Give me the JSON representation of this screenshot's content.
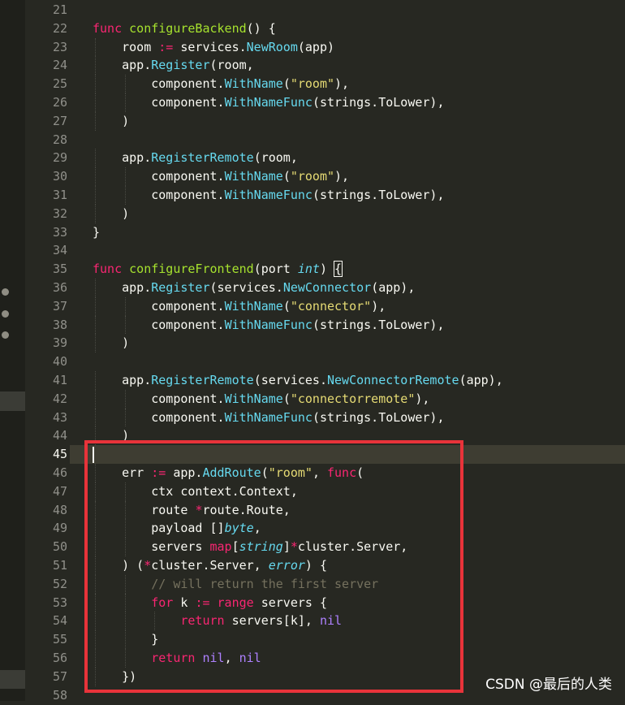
{
  "editor": {
    "lines": [
      {
        "n": "21",
        "segs": []
      },
      {
        "n": "22",
        "segs": [
          [
            "kw",
            "func"
          ],
          [
            "p",
            " "
          ],
          [
            "fn",
            "configureBackend"
          ],
          [
            "p",
            "() {"
          ]
        ]
      },
      {
        "n": "23",
        "segs": [
          [
            "p",
            "    room "
          ],
          [
            "op",
            ":="
          ],
          [
            "p",
            " services."
          ],
          [
            "call",
            "NewRoom"
          ],
          [
            "p",
            "(app)"
          ]
        ]
      },
      {
        "n": "24",
        "segs": [
          [
            "p",
            "    app."
          ],
          [
            "call",
            "Register"
          ],
          [
            "p",
            "(room,"
          ]
        ]
      },
      {
        "n": "25",
        "segs": [
          [
            "p",
            "        component."
          ],
          [
            "call",
            "WithName"
          ],
          [
            "p",
            "("
          ],
          [
            "str",
            "\"room\""
          ],
          [
            "p",
            "),"
          ]
        ]
      },
      {
        "n": "26",
        "segs": [
          [
            "p",
            "        component."
          ],
          [
            "call",
            "WithNameFunc"
          ],
          [
            "p",
            "(strings.ToLower),"
          ]
        ]
      },
      {
        "n": "27",
        "segs": [
          [
            "p",
            "    )"
          ]
        ]
      },
      {
        "n": "28",
        "segs": []
      },
      {
        "n": "29",
        "segs": [
          [
            "p",
            "    app."
          ],
          [
            "call",
            "RegisterRemote"
          ],
          [
            "p",
            "(room,"
          ]
        ]
      },
      {
        "n": "30",
        "segs": [
          [
            "p",
            "        component."
          ],
          [
            "call",
            "WithName"
          ],
          [
            "p",
            "("
          ],
          [
            "str",
            "\"room\""
          ],
          [
            "p",
            "),"
          ]
        ]
      },
      {
        "n": "31",
        "segs": [
          [
            "p",
            "        component."
          ],
          [
            "call",
            "WithNameFunc"
          ],
          [
            "p",
            "(strings.ToLower),"
          ]
        ]
      },
      {
        "n": "32",
        "segs": [
          [
            "p",
            "    )"
          ]
        ]
      },
      {
        "n": "33",
        "segs": [
          [
            "p",
            "}"
          ]
        ]
      },
      {
        "n": "34",
        "segs": []
      },
      {
        "n": "35",
        "segs": [
          [
            "kw",
            "func"
          ],
          [
            "p",
            " "
          ],
          [
            "fn",
            "configureFrontend"
          ],
          [
            "p",
            "(port "
          ],
          [
            "type",
            "int"
          ],
          [
            "p",
            ") "
          ],
          [
            "brm",
            "{"
          ]
        ]
      },
      {
        "n": "36",
        "segs": [
          [
            "p",
            "    app."
          ],
          [
            "call",
            "Register"
          ],
          [
            "p",
            "(services."
          ],
          [
            "call",
            "NewConnector"
          ],
          [
            "p",
            "(app),"
          ]
        ]
      },
      {
        "n": "37",
        "segs": [
          [
            "p",
            "        component."
          ],
          [
            "call",
            "WithName"
          ],
          [
            "p",
            "("
          ],
          [
            "str",
            "\"connector\""
          ],
          [
            "p",
            "),"
          ]
        ]
      },
      {
        "n": "38",
        "segs": [
          [
            "p",
            "        component."
          ],
          [
            "call",
            "WithNameFunc"
          ],
          [
            "p",
            "(strings.ToLower),"
          ]
        ]
      },
      {
        "n": "39",
        "segs": [
          [
            "p",
            "    )"
          ]
        ]
      },
      {
        "n": "40",
        "segs": []
      },
      {
        "n": "41",
        "segs": [
          [
            "p",
            "    app."
          ],
          [
            "call",
            "RegisterRemote"
          ],
          [
            "p",
            "(services."
          ],
          [
            "call",
            "NewConnectorRemote"
          ],
          [
            "p",
            "(app),"
          ]
        ]
      },
      {
        "n": "42",
        "segs": [
          [
            "p",
            "        component."
          ],
          [
            "call",
            "WithName"
          ],
          [
            "p",
            "("
          ],
          [
            "str",
            "\"connectorremote\""
          ],
          [
            "p",
            "),"
          ]
        ]
      },
      {
        "n": "43",
        "segs": [
          [
            "p",
            "        component."
          ],
          [
            "call",
            "WithNameFunc"
          ],
          [
            "p",
            "(strings.ToLower),"
          ]
        ]
      },
      {
        "n": "44",
        "segs": [
          [
            "p",
            "    )"
          ]
        ]
      },
      {
        "n": "45",
        "segs": []
      },
      {
        "n": "46",
        "segs": [
          [
            "p",
            "    err "
          ],
          [
            "op",
            ":="
          ],
          [
            "p",
            " app."
          ],
          [
            "call",
            "AddRoute"
          ],
          [
            "p",
            "("
          ],
          [
            "str",
            "\"room\""
          ],
          [
            "p",
            ", "
          ],
          [
            "kw",
            "func"
          ],
          [
            "p",
            "("
          ]
        ]
      },
      {
        "n": "47",
        "segs": [
          [
            "p",
            "        ctx context.Context,"
          ]
        ]
      },
      {
        "n": "48",
        "segs": [
          [
            "p",
            "        route "
          ],
          [
            "op",
            "*"
          ],
          [
            "p",
            "route.Route,"
          ]
        ]
      },
      {
        "n": "49",
        "segs": [
          [
            "p",
            "        payload []"
          ],
          [
            "type",
            "byte"
          ],
          [
            "p",
            ","
          ]
        ]
      },
      {
        "n": "50",
        "segs": [
          [
            "p",
            "        servers "
          ],
          [
            "kw",
            "map"
          ],
          [
            "p",
            "["
          ],
          [
            "type",
            "string"
          ],
          [
            "p",
            "]"
          ],
          [
            "op",
            "*"
          ],
          [
            "p",
            "cluster.Server,"
          ]
        ]
      },
      {
        "n": "51",
        "segs": [
          [
            "p",
            "    ) ("
          ],
          [
            "op",
            "*"
          ],
          [
            "p",
            "cluster.Server, "
          ],
          [
            "type",
            "error"
          ],
          [
            "p",
            ") {"
          ]
        ]
      },
      {
        "n": "52",
        "segs": [
          [
            "p",
            "        "
          ],
          [
            "cm",
            "// will return the first server"
          ]
        ]
      },
      {
        "n": "53",
        "segs": [
          [
            "p",
            "        "
          ],
          [
            "kw",
            "for"
          ],
          [
            "p",
            " k "
          ],
          [
            "op",
            ":="
          ],
          [
            "p",
            " "
          ],
          [
            "kw",
            "range"
          ],
          [
            "p",
            " servers {"
          ]
        ]
      },
      {
        "n": "54",
        "segs": [
          [
            "p",
            "            "
          ],
          [
            "kw",
            "return"
          ],
          [
            "p",
            " servers[k], "
          ],
          [
            "num",
            "nil"
          ]
        ]
      },
      {
        "n": "55",
        "segs": [
          [
            "p",
            "        }"
          ]
        ]
      },
      {
        "n": "56",
        "segs": [
          [
            "p",
            "        "
          ],
          [
            "kw",
            "return"
          ],
          [
            "p",
            " "
          ],
          [
            "num",
            "nil"
          ],
          [
            "p",
            ", "
          ],
          [
            "num",
            "nil"
          ]
        ]
      },
      {
        "n": "57",
        "segs": [
          [
            "p",
            "    })"
          ]
        ]
      },
      {
        "n": "58",
        "segs": []
      }
    ],
    "active_line": "45"
  },
  "watermark": "CSDN @最后的人类",
  "colors": {
    "background": "#272822",
    "highlight_box": "#e8333a",
    "keyword": "#f92672",
    "function": "#a6e22e",
    "call": "#66d9ef",
    "string": "#e6db74",
    "comment": "#75715e",
    "constant": "#ae81ff"
  }
}
